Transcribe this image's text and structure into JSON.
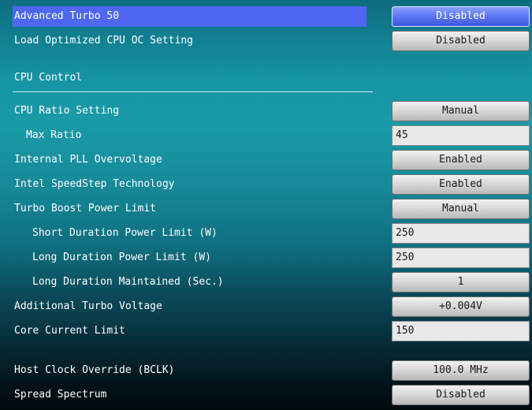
{
  "settings": {
    "advanced_turbo": {
      "label": "Advanced Turbo 50",
      "value": "Disabled"
    },
    "load_optimized": {
      "label": "Load Optimized CPU OC Setting",
      "value": "Disabled"
    },
    "cpu_control_header": "CPU Control",
    "cpu_ratio": {
      "label": "CPU Ratio Setting",
      "value": "Manual"
    },
    "max_ratio": {
      "label": "Max Ratio",
      "value": "45"
    },
    "internal_pll": {
      "label": "Internal PLL Overvoltage",
      "value": "Enabled"
    },
    "speedstep": {
      "label": "Intel SpeedStep Technology",
      "value": "Enabled"
    },
    "turbo_boost_limit": {
      "label": "Turbo Boost Power Limit",
      "value": "Manual"
    },
    "short_duration": {
      "label": "Short Duration Power Limit (W)",
      "value": "250"
    },
    "long_duration": {
      "label": "Long Duration Power Limit (W)",
      "value": "250"
    },
    "long_maintained": {
      "label": "Long Duration Maintained (Sec.)",
      "value": "1"
    },
    "additional_turbo_voltage": {
      "label": "Additional Turbo Voltage",
      "value": "+0.004V"
    },
    "core_current_limit": {
      "label": "Core Current Limit",
      "value": "150"
    },
    "host_clock_override": {
      "label": "Host Clock Override (BCLK)",
      "value": "100.0 MHz"
    },
    "spread_spectrum": {
      "label": "Spread Spectrum",
      "value": "Disabled"
    }
  },
  "colors": {
    "highlight": "#4d67f2",
    "selected_button": "#5872f2",
    "background_top": "#0e6c80",
    "background_bottom": "#020a0e"
  }
}
